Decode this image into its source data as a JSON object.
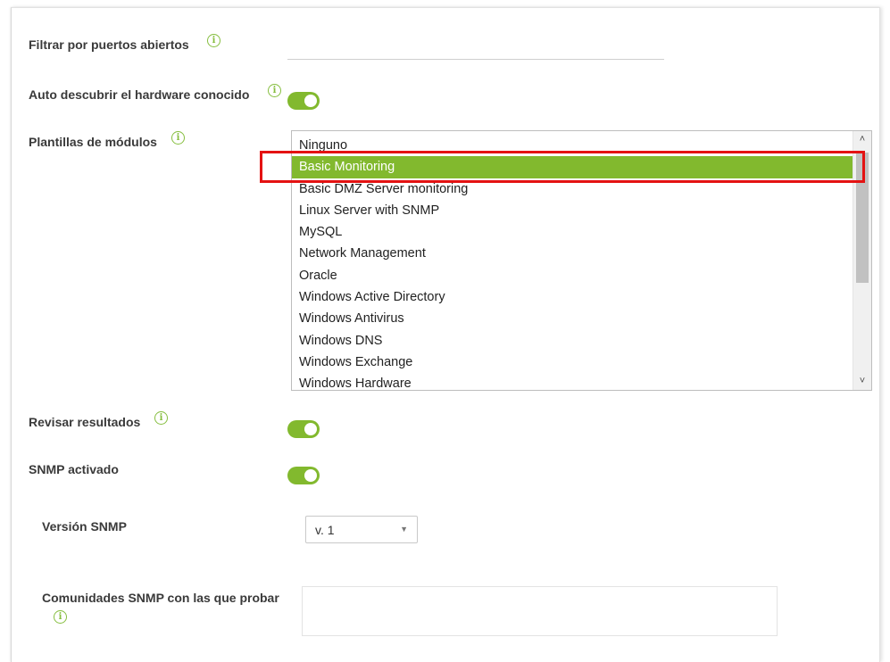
{
  "fields": {
    "open_ports": {
      "label": "Filtrar por puertos abiertos",
      "value": ""
    },
    "auto_discover": {
      "label": "Auto descubrir el hardware conocido",
      "enabled": true
    },
    "module_templates": {
      "label": "Plantillas de módulos",
      "options": [
        "Ninguno",
        "Basic Monitoring",
        "Basic DMZ Server monitoring",
        "Linux Server with SNMP",
        "MySQL",
        "Network Management",
        "Oracle",
        "Windows Active Directory",
        "Windows Antivirus",
        "Windows DNS",
        "Windows Exchange",
        "Windows Hardware"
      ],
      "selected": "Basic Monitoring"
    },
    "review_results": {
      "label": "Revisar resultados",
      "enabled": true
    },
    "snmp_enabled": {
      "label": "SNMP activado",
      "enabled": true
    },
    "snmp_version": {
      "label": "Versión SNMP",
      "selected": "v. 1"
    },
    "snmp_communities": {
      "label": "Comunidades SNMP con las que probar",
      "value": ""
    }
  },
  "icons": {
    "info": "info-icon",
    "scroll_up": "chevron-up-icon",
    "scroll_down": "chevron-down-icon",
    "select_caret": "caret-down-icon"
  },
  "colors": {
    "accent_green": "#82b92e",
    "highlight_red": "#e41212"
  }
}
